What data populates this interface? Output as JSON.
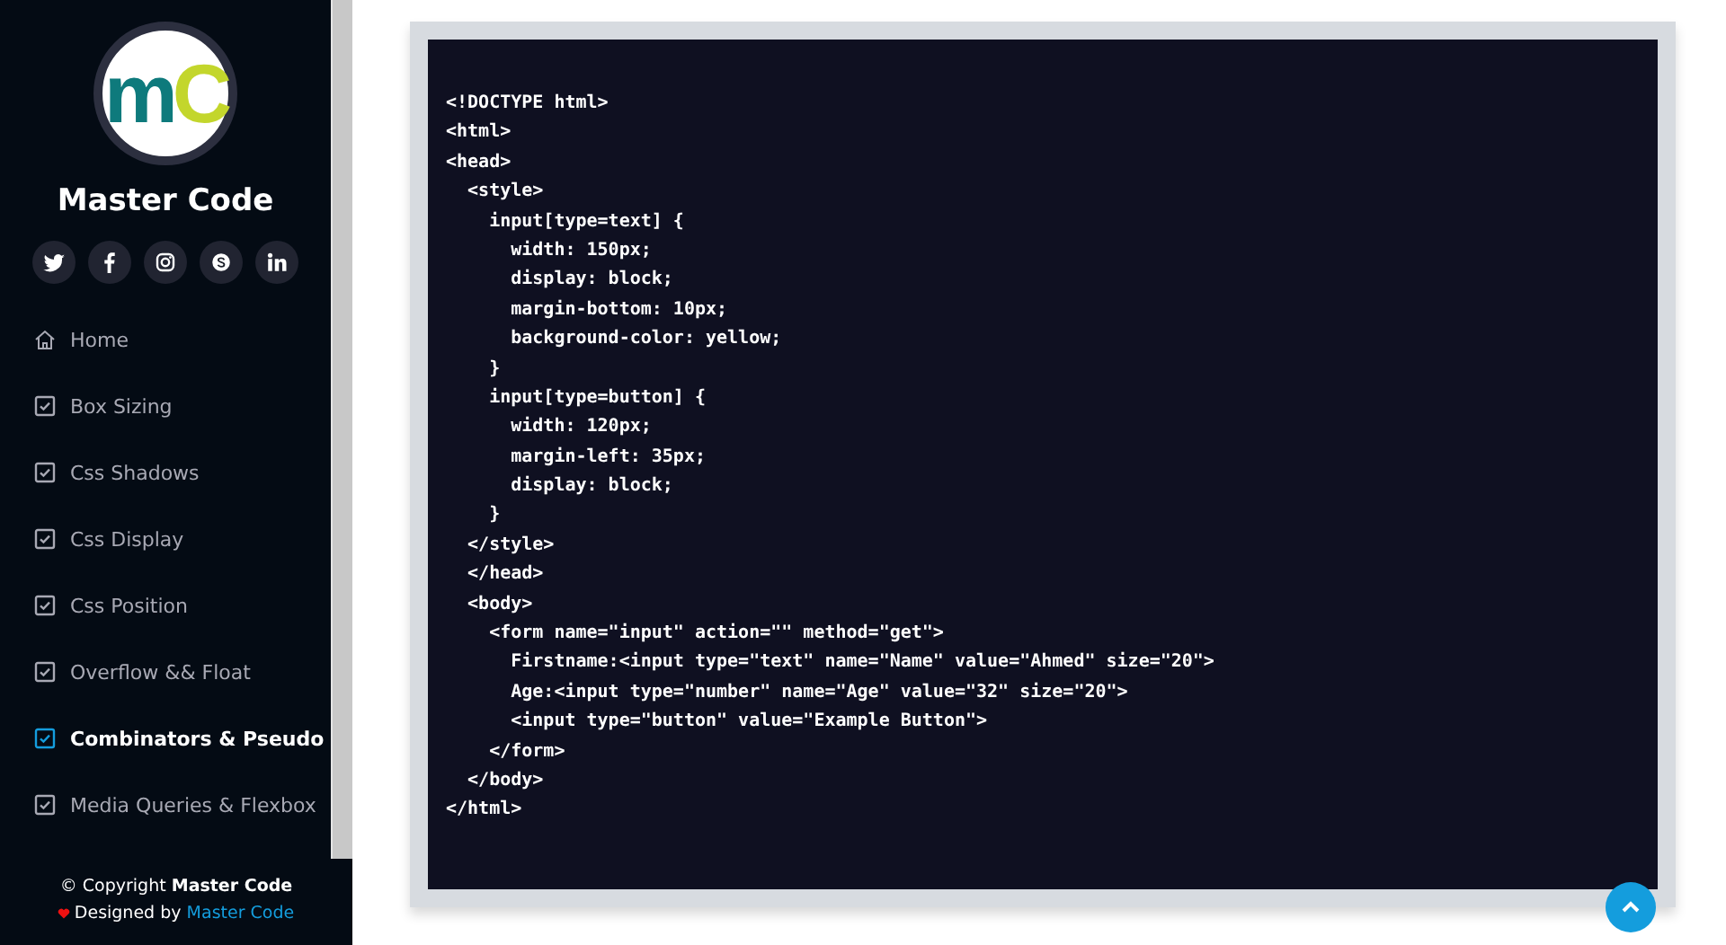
{
  "sidebar": {
    "logo_letters": [
      {
        "text": "m",
        "color": "#0e7a7c"
      },
      {
        "text": "C",
        "color": "#c3d62c"
      }
    ],
    "title": "Master Code",
    "items": [
      {
        "label": "Home",
        "kind": "home",
        "selected": false
      },
      {
        "label": "Box Sizing",
        "kind": "page",
        "selected": false
      },
      {
        "label": "Css Shadows",
        "kind": "page",
        "selected": false
      },
      {
        "label": "Css Display",
        "kind": "page",
        "selected": false
      },
      {
        "label": "Css Position",
        "kind": "page",
        "selected": false
      },
      {
        "label": "Overflow && Float",
        "kind": "page",
        "selected": false
      },
      {
        "label": "Combinators & Pseudo",
        "kind": "page",
        "selected": true
      },
      {
        "label": "Media Queries & Flexbox",
        "kind": "page",
        "selected": false
      }
    ],
    "copyright": "© Copyright **Master Code**",
    "credit": "Designed by",
    "credit_link": "Master Code"
  },
  "code": [
    "<!DOCTYPE html>",
    "<html>",
    "<head>",
    "  <style>",
    "    input[type=text] {",
    "      width: 150px;",
    "      display: block;",
    "      margin-bottom: 10px;",
    "      background-color: yellow;",
    "    }",
    "    input[type=button] {",
    "      width: 120px;",
    "      margin-left: 35px;",
    "      display: block;",
    "    }",
    "  </style>",
    "  </head>",
    "  <body>",
    "    <form name=\"input\" action=\"\" method=\"get\">",
    "      Firstname:<input type=\"text\" name=\"Name\" value=\"Ahmed\" size=\"20\">",
    "      Age:<input type=\"number\" name=\"Age\" value=\"32\" size=\"20\">",
    "      <input type=\"button\" value=\"Example Button\">",
    "    </form>",
    "  </body>",
    "</html>"
  ]
}
